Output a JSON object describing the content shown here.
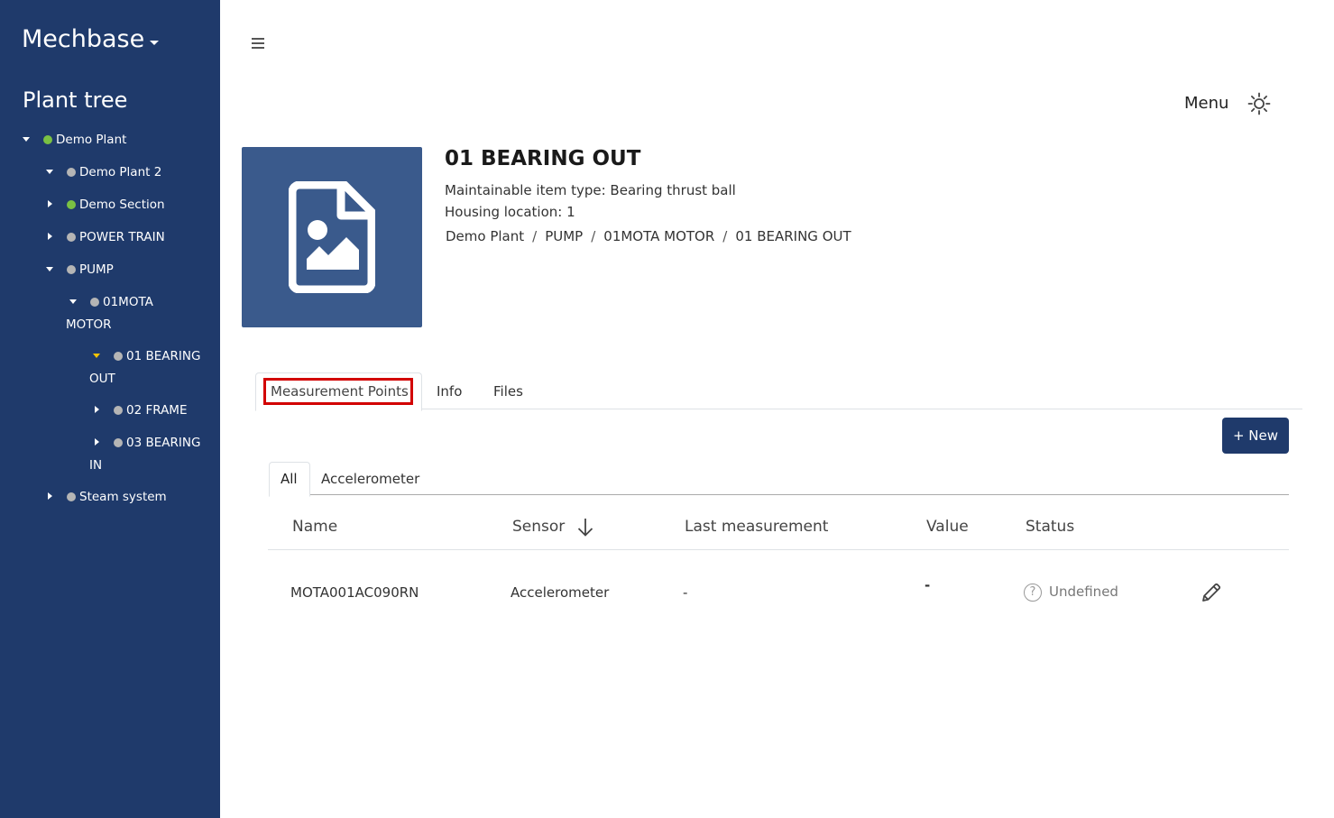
{
  "app": {
    "brand": "Mechbase"
  },
  "sidebar": {
    "title": "Plant tree",
    "nodes": [
      {
        "label": "Demo Plant",
        "status": "green",
        "expanded": true
      },
      {
        "label": "Demo Plant 2",
        "status": "grey",
        "expanded": true
      },
      {
        "label": "Demo Section",
        "status": "green",
        "expanded": false
      },
      {
        "label": "POWER TRAIN",
        "status": "grey",
        "expanded": false
      },
      {
        "label": "PUMP",
        "status": "grey",
        "expanded": true
      },
      {
        "label": "01MOTA",
        "label2": "MOTOR",
        "status": "grey",
        "expanded": true
      },
      {
        "label": "01 BEARING",
        "label2": "OUT",
        "status": "grey",
        "expanded": true,
        "selected": true
      },
      {
        "label": "02 FRAME",
        "status": "grey",
        "expanded": false
      },
      {
        "label": "03 BEARING",
        "label2": "IN",
        "status": "grey",
        "expanded": false
      },
      {
        "label": "Steam system",
        "status": "grey",
        "expanded": false
      }
    ]
  },
  "header": {
    "menu_label": "Menu"
  },
  "item": {
    "title": "01 BEARING OUT",
    "type_line": "Maintainable item type: Bearing thrust ball",
    "housing_line": "Housing location: 1",
    "breadcrumb": [
      "Demo Plant",
      "PUMP",
      "01MOTA MOTOR",
      "01 BEARING OUT"
    ]
  },
  "tabs": [
    "Measurement Points",
    "Info",
    "Files"
  ],
  "new_button": "+ New",
  "subtabs": [
    "All",
    "Accelerometer"
  ],
  "table": {
    "columns": [
      "Name",
      "Sensor",
      "Last measurement",
      "Value",
      "Status"
    ],
    "rows": [
      {
        "name": "MOTA001AC090RN",
        "sensor": "Accelerometer",
        "last_measurement": "-",
        "value": "-",
        "status": "Undefined"
      }
    ]
  },
  "colors": {
    "sidebar": "#1f3a6b",
    "status_green": "#7ac143",
    "status_grey": "#b5b5b5",
    "highlight": "#d20000",
    "selected_caret": "#f5c400"
  }
}
